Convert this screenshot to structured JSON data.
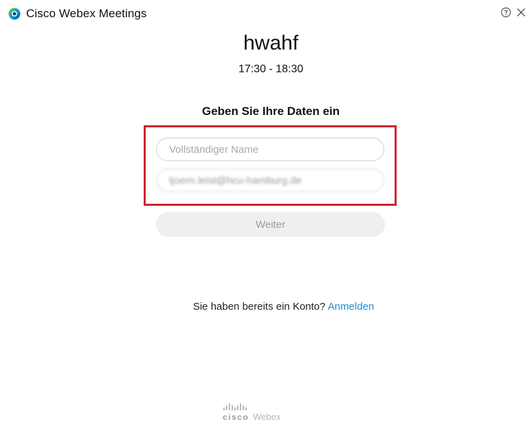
{
  "app": {
    "title": "Cisco Webex Meetings",
    "logo_icon": "webex-logo-icon",
    "help_icon": "help-circle-icon",
    "close_icon": "close-icon"
  },
  "meeting": {
    "title": "hwahf",
    "time": "17:30 - 18:30"
  },
  "form": {
    "heading": "Geben Sie Ihre Daten ein",
    "name_placeholder": "Vollständiger Name",
    "name_value": "",
    "email_value": "tjoern.leist@hcu-hamburg.de",
    "continue_label": "Weiter"
  },
  "account": {
    "prompt": "Sie haben bereits ein Konto?",
    "signin_label": "Anmelden"
  },
  "footer": {
    "brand": "cisco",
    "product": "Webex"
  },
  "colors": {
    "highlight": "#d0232e",
    "link": "#1e8fd1",
    "button_bg": "#efefef"
  }
}
